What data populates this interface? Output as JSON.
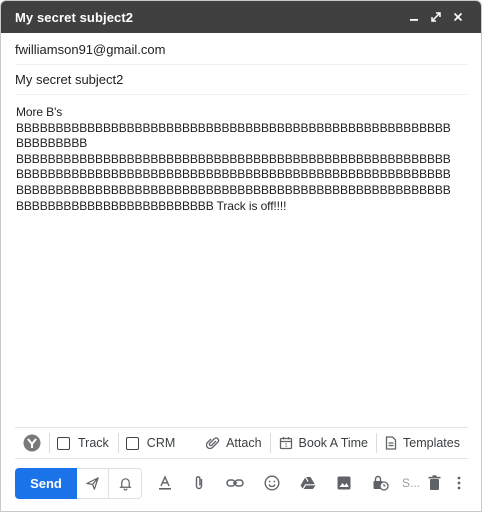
{
  "window": {
    "title": "My secret subject2"
  },
  "compose": {
    "to": "fwilliamson91@gmail.com",
    "subject": "My secret subject2",
    "body_lines": [
      "More B's",
      "BBBBBBBBBBBBBBBBBBBBBBBBBBBBBBBBBBBBBBBBBBBBBBBBBBBBBBB",
      "BBBBBBBBB",
      "BBBBBBBBBBBBBBBBBBBBBBBBBBBBBBBBBBBBBBBBBBBBBBBBBBBBBBB",
      "BBBBBBBBBBBBBBBBBBBBBBBBBBBBBBBBBBBBBBBBBBBBBBBBBBBBBBB",
      "BBBBBBBBBBBBBBBBBBBBBBBBBBBBBBBBBBBBBBBBBBBBBBBBBBBBBBB",
      "BBBBBBBBBBBBBBBBBBBBBBBBB Track is off!!!!"
    ]
  },
  "crm_bar": {
    "track_label": "Track",
    "crm_label": "CRM",
    "attach_label": "Attach",
    "book_label": "Book A Time",
    "templates_label": "Templates"
  },
  "toolbar": {
    "send_label": "Send",
    "s_label": "S..."
  },
  "colors": {
    "titlebar": "#404040",
    "send": "#1a73e8"
  },
  "icons": {
    "minimize": "minimize-icon",
    "expand": "expand-icon",
    "close": "close-icon"
  }
}
